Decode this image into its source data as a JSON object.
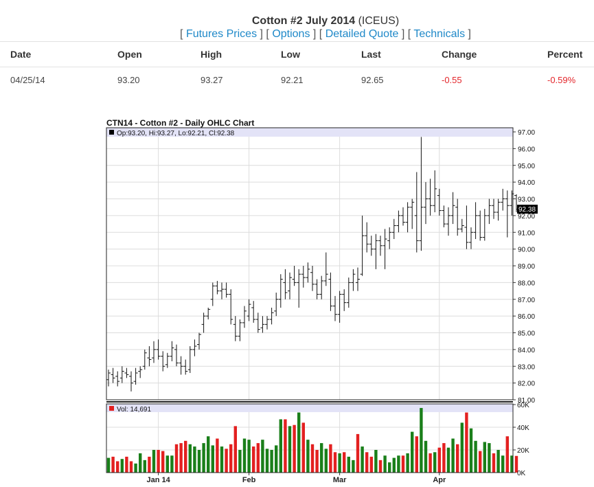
{
  "header": {
    "title_bold": "Cotton #2 July 2014",
    "title_suffix": " (ICEUS)",
    "links": [
      "Futures Prices",
      "Options",
      "Detailed Quote",
      "Technicals"
    ]
  },
  "quote_table": {
    "columns": [
      "Date",
      "Open",
      "High",
      "Low",
      "Last",
      "Change",
      "Percent"
    ],
    "row": [
      "04/25/14",
      "93.20",
      "93.27",
      "92.21",
      "92.65",
      "-0.55",
      "-0.59%"
    ]
  },
  "colors": {
    "link": "#1e88c8",
    "negative": "#e3262b",
    "vol_up": "#1a7f1a",
    "vol_down": "#e32020",
    "legend_bg": "#e3e3f7"
  },
  "chart_data": {
    "type": "ohlc",
    "title": "CTN14 - Cotton #2 - Daily OHLC Chart",
    "price_legend": "Op:93.20, Hi:93.27, Lo:92.21, Cl:92.38",
    "last_price_tag": "92.38",
    "ylim": [
      81,
      97
    ],
    "price_ticks": [
      "81.00",
      "82.00",
      "83.00",
      "84.00",
      "85.00",
      "86.00",
      "87.00",
      "88.00",
      "89.00",
      "90.00",
      "91.00",
      "92.00",
      "93.00",
      "94.00",
      "95.00",
      "96.00",
      "97.00"
    ],
    "x_labels": [
      "Jan 14",
      "Feb",
      "Mar",
      "Apr"
    ],
    "x_label_index": [
      11,
      31,
      51,
      73
    ],
    "volume": {
      "legend": "Vol: 14,691",
      "ylim": [
        0,
        60000
      ],
      "ticks": [
        "0K",
        "20K",
        "40K",
        "60K"
      ]
    },
    "bars": [
      {
        "o": 82.2,
        "h": 82.8,
        "l": 81.8,
        "c": 82.6,
        "v": 13000
      },
      {
        "o": 82.5,
        "h": 82.9,
        "l": 82.0,
        "c": 82.3,
        "v": 14000
      },
      {
        "o": 82.4,
        "h": 82.7,
        "l": 81.8,
        "c": 82.1,
        "v": 10000
      },
      {
        "o": 82.3,
        "h": 83.0,
        "l": 82.0,
        "c": 82.7,
        "v": 12000
      },
      {
        "o": 82.6,
        "h": 82.9,
        "l": 82.3,
        "c": 82.5,
        "v": 14000
      },
      {
        "o": 82.4,
        "h": 82.7,
        "l": 81.5,
        "c": 82.0,
        "v": 10000
      },
      {
        "o": 82.1,
        "h": 82.9,
        "l": 81.9,
        "c": 82.6,
        "v": 8000
      },
      {
        "o": 82.7,
        "h": 83.0,
        "l": 82.3,
        "c": 82.8,
        "v": 17000
      },
      {
        "o": 83.0,
        "h": 84.0,
        "l": 82.8,
        "c": 83.8,
        "v": 11000
      },
      {
        "o": 83.5,
        "h": 84.2,
        "l": 83.0,
        "c": 83.4,
        "v": 14000
      },
      {
        "o": 83.5,
        "h": 84.5,
        "l": 83.2,
        "c": 84.0,
        "v": 20000
      },
      {
        "o": 84.0,
        "h": 84.6,
        "l": 83.4,
        "c": 83.6,
        "v": 20000
      },
      {
        "o": 83.6,
        "h": 83.9,
        "l": 82.7,
        "c": 83.0,
        "v": 19000
      },
      {
        "o": 83.1,
        "h": 83.8,
        "l": 82.9,
        "c": 83.6,
        "v": 15000
      },
      {
        "o": 83.6,
        "h": 84.5,
        "l": 83.3,
        "c": 84.1,
        "v": 15000
      },
      {
        "o": 84.0,
        "h": 84.3,
        "l": 83.0,
        "c": 83.2,
        "v": 25000
      },
      {
        "o": 83.2,
        "h": 83.6,
        "l": 82.5,
        "c": 83.0,
        "v": 26000
      },
      {
        "o": 83.0,
        "h": 83.4,
        "l": 82.5,
        "c": 82.7,
        "v": 28000
      },
      {
        "o": 82.8,
        "h": 84.2,
        "l": 82.6,
        "c": 84.0,
        "v": 25000
      },
      {
        "o": 84.0,
        "h": 84.6,
        "l": 83.6,
        "c": 84.2,
        "v": 23000
      },
      {
        "o": 84.3,
        "h": 85.0,
        "l": 84.0,
        "c": 84.9,
        "v": 20000
      },
      {
        "o": 85.5,
        "h": 86.2,
        "l": 85.0,
        "c": 86.0,
        "v": 26000
      },
      {
        "o": 86.0,
        "h": 86.5,
        "l": 85.8,
        "c": 86.4,
        "v": 32000
      },
      {
        "o": 87.0,
        "h": 88.0,
        "l": 86.6,
        "c": 87.8,
        "v": 24000
      },
      {
        "o": 87.8,
        "h": 88.1,
        "l": 87.3,
        "c": 87.5,
        "v": 30000
      },
      {
        "o": 87.5,
        "h": 88.0,
        "l": 87.0,
        "c": 87.6,
        "v": 23000
      },
      {
        "o": 87.6,
        "h": 88.0,
        "l": 87.1,
        "c": 87.3,
        "v": 21000
      },
      {
        "o": 87.3,
        "h": 87.6,
        "l": 85.5,
        "c": 85.8,
        "v": 25000
      },
      {
        "o": 85.5,
        "h": 86.0,
        "l": 84.5,
        "c": 84.8,
        "v": 41000
      },
      {
        "o": 84.8,
        "h": 85.8,
        "l": 84.5,
        "c": 85.6,
        "v": 20000
      },
      {
        "o": 85.6,
        "h": 86.6,
        "l": 85.3,
        "c": 86.3,
        "v": 30000
      },
      {
        "o": 86.0,
        "h": 87.0,
        "l": 85.7,
        "c": 86.7,
        "v": 29000
      },
      {
        "o": 86.5,
        "h": 86.9,
        "l": 85.6,
        "c": 85.8,
        "v": 23000
      },
      {
        "o": 85.8,
        "h": 86.2,
        "l": 85.0,
        "c": 85.2,
        "v": 26000
      },
      {
        "o": 85.3,
        "h": 86.0,
        "l": 85.0,
        "c": 85.5,
        "v": 29000
      },
      {
        "o": 85.5,
        "h": 86.0,
        "l": 85.2,
        "c": 85.8,
        "v": 21000
      },
      {
        "o": 85.8,
        "h": 86.5,
        "l": 85.5,
        "c": 86.2,
        "v": 20000
      },
      {
        "o": 86.3,
        "h": 87.4,
        "l": 86.0,
        "c": 87.0,
        "v": 24000
      },
      {
        "o": 87.0,
        "h": 88.5,
        "l": 86.5,
        "c": 88.2,
        "v": 47000
      },
      {
        "o": 88.0,
        "h": 88.8,
        "l": 87.0,
        "c": 87.4,
        "v": 47000
      },
      {
        "o": 87.5,
        "h": 88.6,
        "l": 87.0,
        "c": 88.3,
        "v": 41000
      },
      {
        "o": 88.2,
        "h": 89.0,
        "l": 87.8,
        "c": 88.0,
        "v": 42000
      },
      {
        "o": 88.0,
        "h": 88.8,
        "l": 86.5,
        "c": 88.5,
        "v": 53000
      },
      {
        "o": 88.5,
        "h": 89.0,
        "l": 87.7,
        "c": 88.3,
        "v": 44000
      },
      {
        "o": 88.3,
        "h": 89.2,
        "l": 88.0,
        "c": 88.8,
        "v": 29000
      },
      {
        "o": 88.6,
        "h": 89.0,
        "l": 87.5,
        "c": 87.9,
        "v": 25000
      },
      {
        "o": 87.9,
        "h": 88.2,
        "l": 87.0,
        "c": 87.3,
        "v": 20000
      },
      {
        "o": 87.3,
        "h": 88.4,
        "l": 87.0,
        "c": 88.1,
        "v": 26000
      },
      {
        "o": 88.1,
        "h": 89.8,
        "l": 87.8,
        "c": 88.5,
        "v": 21000
      },
      {
        "o": 88.2,
        "h": 88.6,
        "l": 86.3,
        "c": 86.6,
        "v": 25000
      },
      {
        "o": 86.6,
        "h": 87.2,
        "l": 85.7,
        "c": 86.1,
        "v": 18000
      },
      {
        "o": 86.1,
        "h": 87.5,
        "l": 85.6,
        "c": 87.3,
        "v": 17000
      },
      {
        "o": 87.3,
        "h": 87.6,
        "l": 86.3,
        "c": 86.8,
        "v": 18000
      },
      {
        "o": 86.8,
        "h": 88.3,
        "l": 86.5,
        "c": 88.0,
        "v": 14000
      },
      {
        "o": 88.0,
        "h": 88.8,
        "l": 87.5,
        "c": 88.5,
        "v": 11000
      },
      {
        "o": 88.0,
        "h": 88.9,
        "l": 87.5,
        "c": 88.2,
        "v": 34000
      },
      {
        "o": 88.5,
        "h": 92.0,
        "l": 88.4,
        "c": 90.8,
        "v": 23000
      },
      {
        "o": 90.8,
        "h": 91.6,
        "l": 89.8,
        "c": 90.3,
        "v": 18000
      },
      {
        "o": 90.3,
        "h": 90.8,
        "l": 89.6,
        "c": 90.0,
        "v": 14000
      },
      {
        "o": 90.0,
        "h": 90.9,
        "l": 88.8,
        "c": 90.5,
        "v": 20000
      },
      {
        "o": 90.5,
        "h": 90.8,
        "l": 89.6,
        "c": 90.2,
        "v": 11000
      },
      {
        "o": 90.2,
        "h": 91.2,
        "l": 88.8,
        "c": 90.6,
        "v": 15000
      },
      {
        "o": 90.5,
        "h": 91.3,
        "l": 90.0,
        "c": 91.0,
        "v": 9000
      },
      {
        "o": 91.0,
        "h": 91.8,
        "l": 90.6,
        "c": 91.4,
        "v": 13000
      },
      {
        "o": 91.4,
        "h": 92.3,
        "l": 91.0,
        "c": 92.0,
        "v": 15000
      },
      {
        "o": 92.0,
        "h": 92.5,
        "l": 91.4,
        "c": 91.6,
        "v": 15000
      },
      {
        "o": 91.6,
        "h": 92.8,
        "l": 91.0,
        "c": 92.5,
        "v": 17000
      },
      {
        "o": 92.5,
        "h": 93.0,
        "l": 91.2,
        "c": 92.8,
        "v": 36000
      },
      {
        "o": 92.0,
        "h": 94.6,
        "l": 89.8,
        "c": 90.5,
        "v": 32000
      },
      {
        "o": 90.5,
        "h": 96.7,
        "l": 89.9,
        "c": 92.5,
        "v": 57000
      },
      {
        "o": 92.5,
        "h": 94.0,
        "l": 91.5,
        "c": 93.0,
        "v": 28000
      },
      {
        "o": 93.0,
        "h": 94.2,
        "l": 92.0,
        "c": 92.6,
        "v": 17000
      },
      {
        "o": 92.6,
        "h": 94.7,
        "l": 92.2,
        "c": 93.6,
        "v": 18000
      },
      {
        "o": 93.2,
        "h": 93.6,
        "l": 92.0,
        "c": 92.3,
        "v": 22000
      },
      {
        "o": 92.3,
        "h": 92.6,
        "l": 91.3,
        "c": 91.5,
        "v": 26000
      },
      {
        "o": 91.5,
        "h": 92.5,
        "l": 90.8,
        "c": 92.0,
        "v": 22000
      },
      {
        "o": 92.0,
        "h": 93.4,
        "l": 91.5,
        "c": 92.6,
        "v": 30000
      },
      {
        "o": 92.5,
        "h": 93.0,
        "l": 90.8,
        "c": 91.2,
        "v": 25000
      },
      {
        "o": 91.2,
        "h": 91.8,
        "l": 91.0,
        "c": 91.4,
        "v": 44000
      },
      {
        "o": 91.3,
        "h": 92.6,
        "l": 90.0,
        "c": 90.4,
        "v": 53000
      },
      {
        "o": 90.4,
        "h": 91.3,
        "l": 90.0,
        "c": 91.0,
        "v": 39000
      },
      {
        "o": 91.0,
        "h": 92.8,
        "l": 90.6,
        "c": 92.0,
        "v": 28000
      },
      {
        "o": 92.0,
        "h": 92.3,
        "l": 90.5,
        "c": 90.7,
        "v": 19000
      },
      {
        "o": 90.7,
        "h": 92.4,
        "l": 90.5,
        "c": 92.0,
        "v": 27000
      },
      {
        "o": 92.0,
        "h": 93.0,
        "l": 91.5,
        "c": 92.6,
        "v": 26000
      },
      {
        "o": 92.6,
        "h": 93.0,
        "l": 91.8,
        "c": 92.2,
        "v": 17000
      },
      {
        "o": 92.2,
        "h": 93.0,
        "l": 91.7,
        "c": 92.8,
        "v": 20000
      },
      {
        "o": 92.8,
        "h": 93.6,
        "l": 92.3,
        "c": 93.0,
        "v": 15000
      },
      {
        "o": 93.0,
        "h": 93.5,
        "l": 90.7,
        "c": 92.6,
        "v": 32000
      },
      {
        "o": 92.6,
        "h": 93.5,
        "l": 92.0,
        "c": 93.3,
        "v": 15000
      },
      {
        "o": 93.2,
        "h": 93.27,
        "l": 92.21,
        "c": 92.38,
        "v": 14691
      }
    ]
  }
}
